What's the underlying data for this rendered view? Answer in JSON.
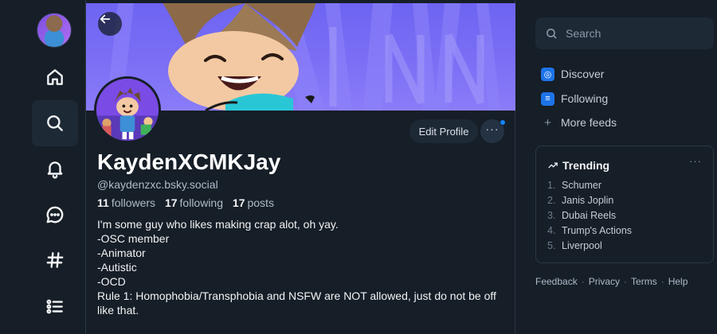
{
  "profile": {
    "display_name": "KaydenXCMKJay",
    "handle": "@kaydenzxc.bsky.social",
    "followers_count": "11",
    "followers_label": "followers",
    "following_count": "17",
    "following_label": "following",
    "posts_count": "17",
    "posts_label": "posts",
    "bio_lines": [
      "I'm some guy who likes making crap alot, oh yay.",
      "-OSC member",
      "-Animator",
      "-Autistic",
      "-OCD",
      "Rule 1: Homophobia/Transphobia and NSFW are NOT allowed, just do not be off like that."
    ],
    "edit_label": "Edit Profile",
    "more_label": "···"
  },
  "nav": {
    "items": [
      "home-icon",
      "search-icon",
      "bell-icon",
      "chat-icon",
      "hashtag-icon",
      "list-icon"
    ]
  },
  "search": {
    "placeholder": "Search"
  },
  "feeds": {
    "discover": "Discover",
    "following": "Following",
    "more": "More feeds"
  },
  "trending": {
    "title": "Trending",
    "more_label": "···",
    "items": [
      {
        "num": "1.",
        "label": "Schumer"
      },
      {
        "num": "2.",
        "label": "Janis Joplin"
      },
      {
        "num": "3.",
        "label": "Dubai Reels"
      },
      {
        "num": "4.",
        "label": "Trump's Actions"
      },
      {
        "num": "5.",
        "label": "Liverpool"
      }
    ]
  },
  "footer": {
    "feedback": "Feedback",
    "privacy": "Privacy",
    "terms": "Terms",
    "help": "Help",
    "sep": "·"
  },
  "colors": {
    "background": "#161e27",
    "accent": "#1185fe",
    "banner": "#6d64f2"
  }
}
